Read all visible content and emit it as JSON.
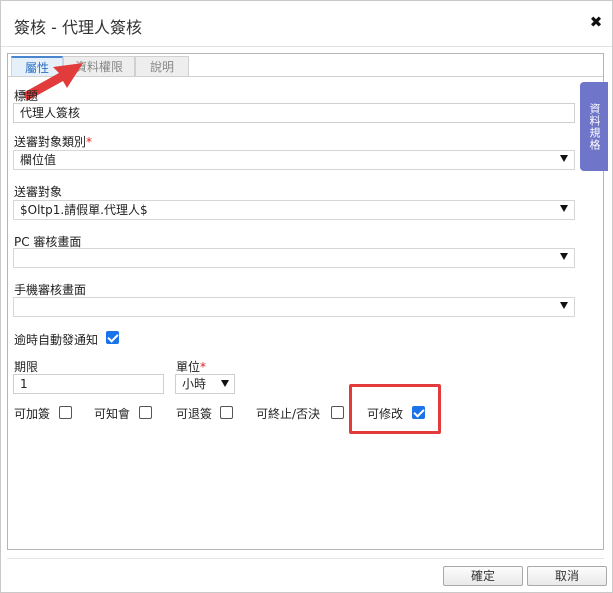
{
  "window": {
    "title": "簽核 - 代理人簽核"
  },
  "tabs": [
    {
      "label": "屬性",
      "active": true
    },
    {
      "label": "資料權限",
      "active": false
    },
    {
      "label": "說明",
      "active": false
    }
  ],
  "side_tab": {
    "label": "資料規格"
  },
  "fields": {
    "name": {
      "label": "標題",
      "value": "代理人簽核"
    },
    "recipient_type": {
      "label": "送審對象類別",
      "required_mark": "*",
      "value": "欄位值"
    },
    "recipient": {
      "label": "送審對象",
      "value": "$Oltp1.請假單.代理人$"
    },
    "pc_form": {
      "label": "PC 審核畫面",
      "value": ""
    },
    "mobile_form": {
      "label": "手機審核畫面",
      "value": ""
    },
    "auto_notify": {
      "label": "逾時自動發通知",
      "checked": true
    },
    "period": {
      "label": "期限",
      "value": "1"
    },
    "unit": {
      "label": "單位",
      "required_mark": "*",
      "value": "小時"
    }
  },
  "options": [
    {
      "label": "可加簽",
      "checked": false
    },
    {
      "label": "可知會",
      "checked": false
    },
    {
      "label": "可退簽",
      "checked": false
    },
    {
      "label": "可終止/否決",
      "checked": false
    },
    {
      "label": "可修改",
      "checked": true
    }
  ],
  "footer": {
    "confirm_label": "確定",
    "cancel_label": "取消"
  },
  "colors": {
    "annotation": "#e23b3b",
    "accent": "#1a73e8",
    "side_tab": "#6f75c8"
  }
}
